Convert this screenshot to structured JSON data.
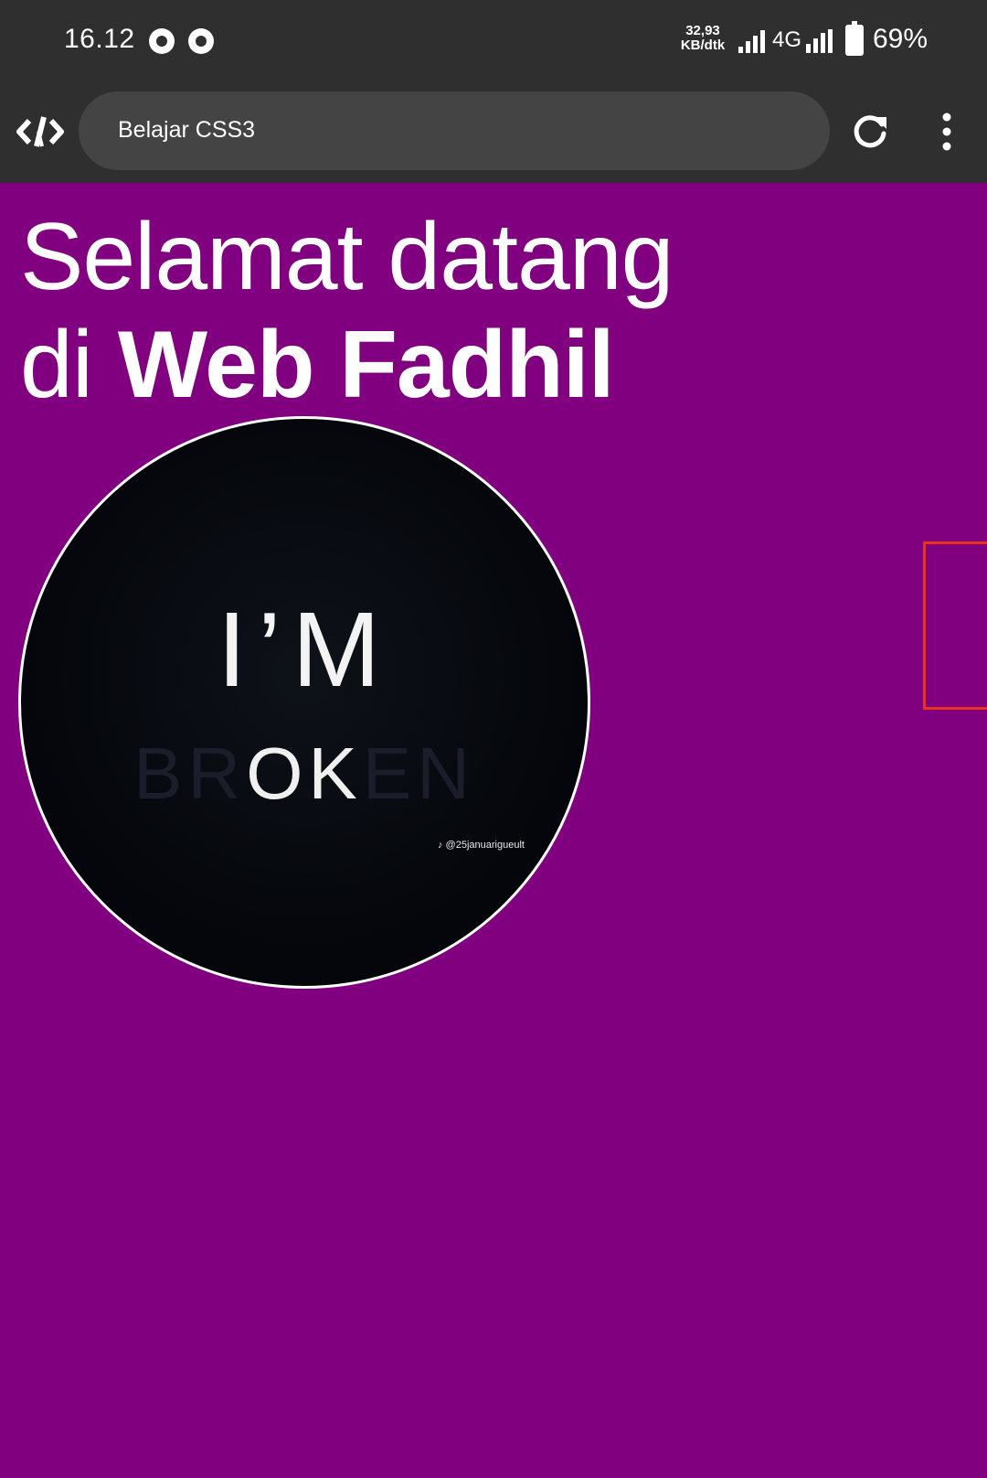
{
  "status_bar": {
    "time": "16.12",
    "speed_value": "32,93",
    "speed_unit": "KB/dtk",
    "network": "4G",
    "battery": "69%"
  },
  "browser": {
    "page_title": "Belajar CSS3"
  },
  "page": {
    "heading_line1": "Selamat datang",
    "heading_line2_prefix": "di ",
    "heading_line2_bold": "Web Fadhil",
    "background_color": "#800080"
  },
  "avatar_image": {
    "main_text": "I’M",
    "sub_text_dim_left": "BR",
    "sub_text_bright": "OK",
    "sub_text_dim_right": "EN",
    "credit": "♪ @25januarigueult"
  }
}
